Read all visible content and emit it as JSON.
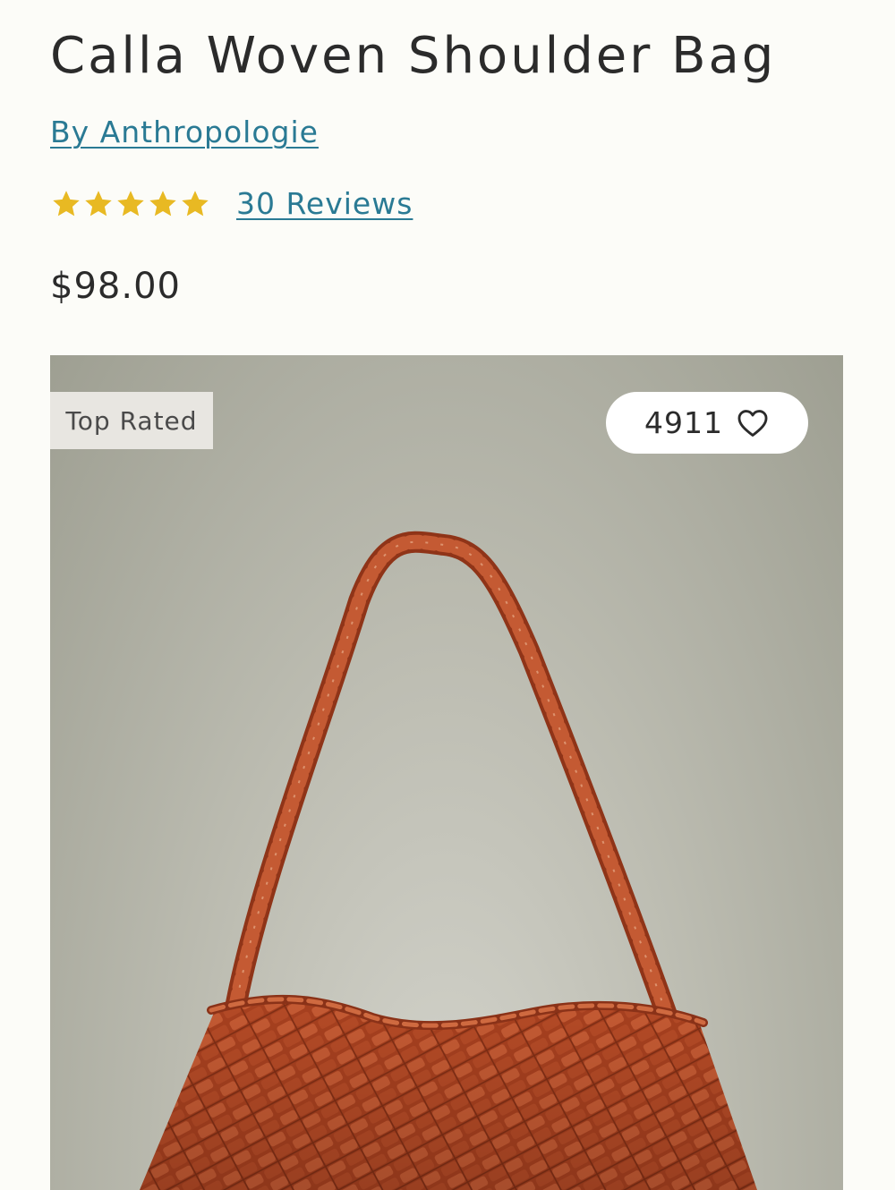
{
  "product": {
    "title": "Calla Woven Shoulder Bag",
    "brand_link": "By Anthropologie",
    "rating": {
      "stars": 5,
      "max": 5,
      "color": "#e8b923"
    },
    "reviews_link": "30 Reviews",
    "price": "$98.00"
  },
  "gallery": {
    "badge": "Top Rated",
    "favorites_count": "4911",
    "favorite_icon": "heart-outline-icon",
    "image_subject": "woven-leather-shoulder-bag",
    "image_color": "#b5482a"
  },
  "colors": {
    "link": "#2a7a94",
    "text": "#2b2b2b",
    "background": "#fcfcf8"
  }
}
